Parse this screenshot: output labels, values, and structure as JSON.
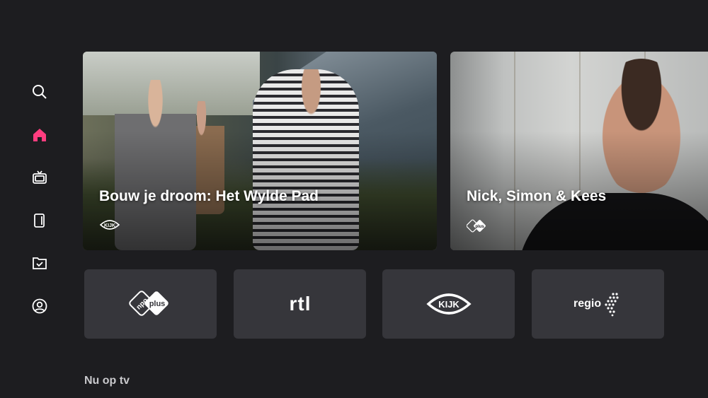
{
  "theme": {
    "accent": "#ff3d7f",
    "background": "#1d1d20",
    "tile": "#36363b"
  },
  "sidebar": {
    "items": [
      {
        "name": "search",
        "icon": "search-icon",
        "active": false
      },
      {
        "name": "home",
        "icon": "home-icon",
        "active": true
      },
      {
        "name": "tv",
        "icon": "tv-icon",
        "active": false
      },
      {
        "name": "on-demand",
        "icon": "tablet-icon",
        "active": false
      },
      {
        "name": "recordings",
        "icon": "check-folder-icon",
        "active": false
      },
      {
        "name": "profile",
        "icon": "user-icon",
        "active": false
      }
    ]
  },
  "hero": {
    "cards": [
      {
        "title": "Bouw je droom: Het Wylde Pad",
        "channel_logo": "kijk"
      },
      {
        "title": "Nick, Simon & Kees",
        "channel_logo": "npo plus"
      }
    ]
  },
  "channels": [
    {
      "npo": "npo",
      "plus": "plus"
    },
    {
      "label": "rtl"
    },
    {
      "label": "KIJK"
    },
    {
      "label": "regio"
    }
  ],
  "sections": {
    "now_on_tv": "Nu op tv"
  }
}
